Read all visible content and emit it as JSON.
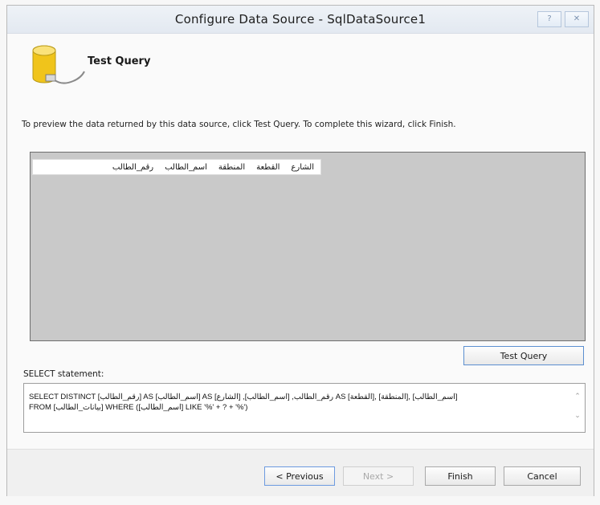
{
  "window": {
    "title": "Configure Data Source - SqlDataSource1",
    "help_glyph": "?",
    "close_glyph": "✕"
  },
  "page": {
    "section_title": "Test Query",
    "instructions": "To preview the data returned by this data source, click Test Query. To complete this wizard, click Finish."
  },
  "grid": {
    "columns": [
      "الشارع",
      "القطعة",
      "المنطقة",
      "اسم_الطالب",
      "رقم_الطالب"
    ]
  },
  "buttons": {
    "test_query": "Test Query",
    "previous": "< Previous",
    "next": "Next >",
    "finish": "Finish",
    "cancel": "Cancel"
  },
  "select": {
    "label": "SELECT statement:",
    "line1": "SELECT DISTINCT [رقم_الطالب] AS [اسم_الطالب] AS رقم_الطالب, [اسم_الطالب], [الشارع] AS [القطعة], [المنطقة], [اسم_الطالب]",
    "line2": "FROM [بيانات_الطالب] WHERE ([اسم_الطالب] LIKE '%' + ? + '%')"
  },
  "icons": {
    "database": "database-icon",
    "scroll_up": "chevron-up-icon",
    "scroll_down": "chevron-down-icon"
  }
}
